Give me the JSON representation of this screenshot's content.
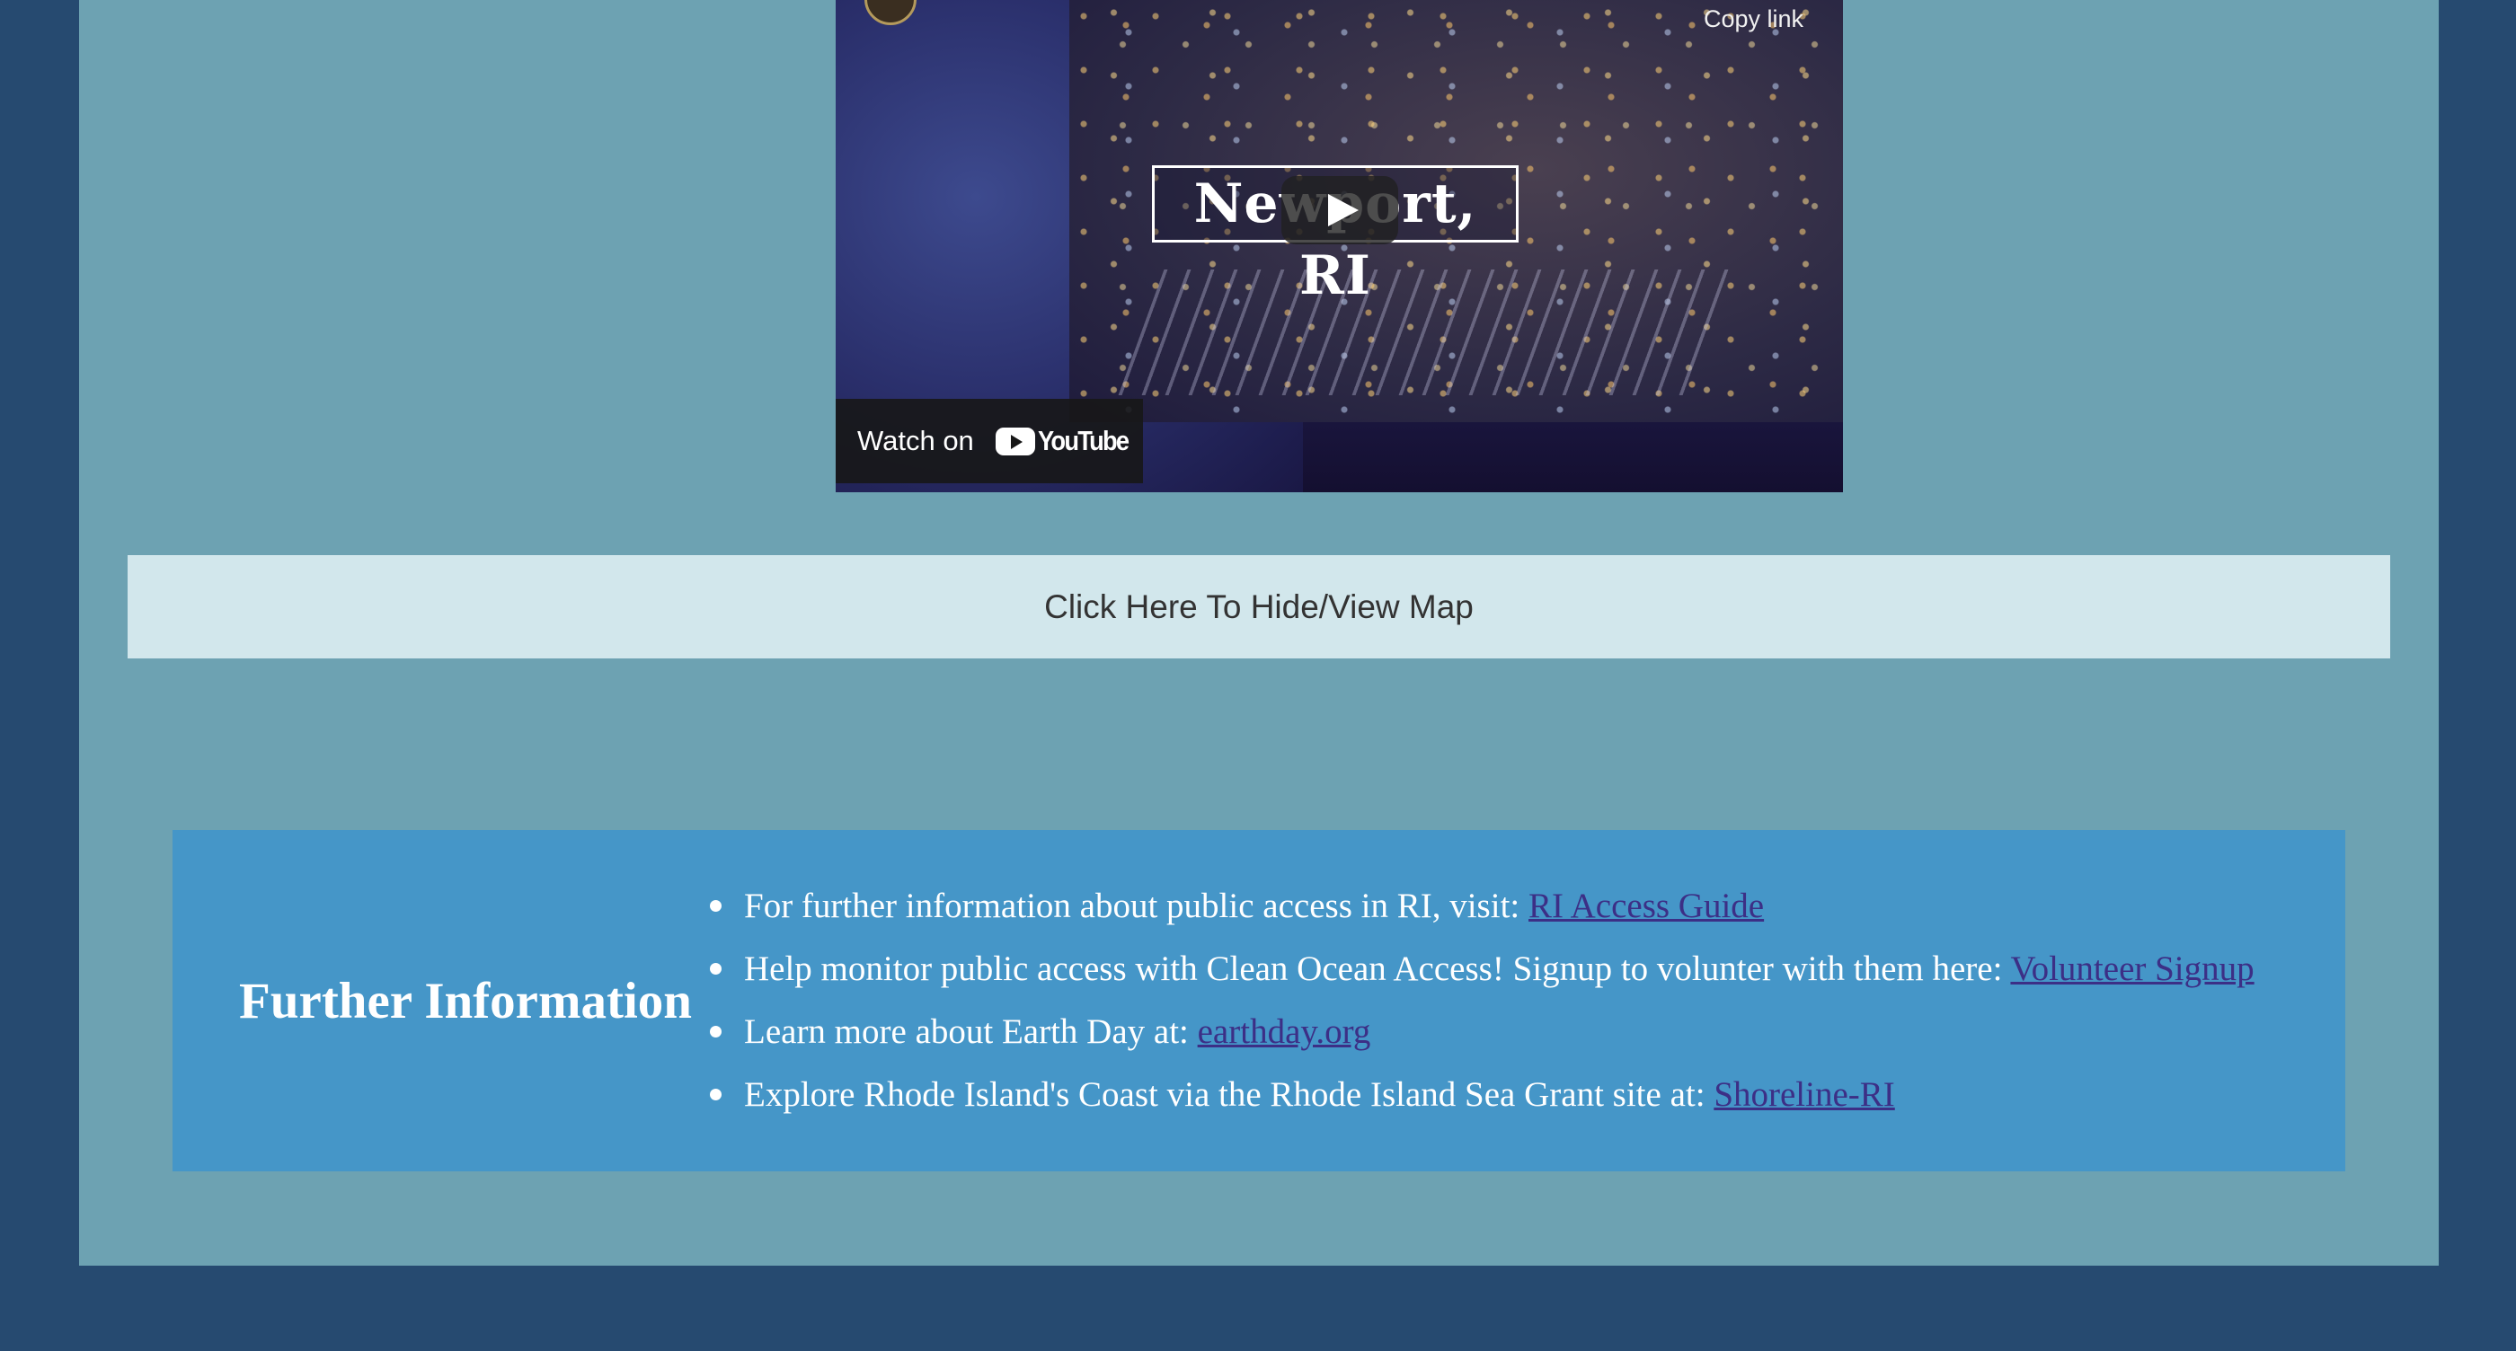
{
  "video": {
    "title_card": "Newport, RI",
    "copy_link": "Copy link",
    "watch_on": "Watch on",
    "youtube_label": "YouTube"
  },
  "map_toggle": {
    "label": "Click Here To Hide/View Map"
  },
  "further_info": {
    "heading": "Further Information",
    "items": [
      {
        "text": "For further information about public access in RI, visit: ",
        "link": "RI Access Guide"
      },
      {
        "text": "Help monitor public access with Clean Ocean Access! Signup to volunter with them here: ",
        "link": "Volunteer Signup"
      },
      {
        "text": "Learn more about Earth Day at: ",
        "link": "earthday.org"
      },
      {
        "text": "Explore Rhode Island's Coast via the Rhode Island Sea Grant site at: ",
        "link": "Shoreline-RI"
      }
    ]
  },
  "colors": {
    "page_background": "#264a70",
    "panel_background": "#6da2b2",
    "map_button_background": "#d2e7ec",
    "info_background": "#4596c8",
    "link_color": "#3c2f86"
  }
}
